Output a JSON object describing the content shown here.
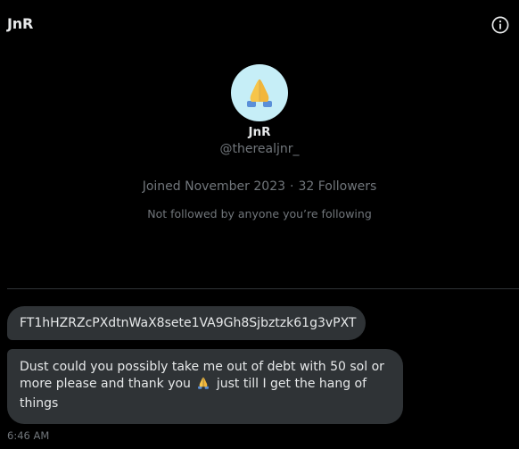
{
  "header": {
    "title": "JnR",
    "info_icon": "info-icon"
  },
  "profile": {
    "avatar_icon": "folded-hands-emoji",
    "avatar_bg": "#c6eef7",
    "name": "JnR",
    "handle": "@therealjnr_",
    "joined": "Joined November 2023",
    "separator": "·",
    "followers": "32 Followers",
    "followed_by": "Not followed by anyone you’re following"
  },
  "messages": [
    {
      "text": "FT1hHZRZcPXdtnWaX8sete1VA9Gh8Sjbztzk61g3vPXT"
    },
    {
      "text_before_emoji": "Dust could you possibly take me out of debt with 50 sol or more please and thank you",
      "emoji": "folded-hands-emoji",
      "text_after_emoji": "just till I get the hang of things"
    }
  ],
  "timestamp": "6:46 AM",
  "colors": {
    "background": "#000000",
    "text": "#e7e9ea",
    "muted": "#71767b",
    "bubble": "#2f3336",
    "divider": "#2f3336"
  }
}
